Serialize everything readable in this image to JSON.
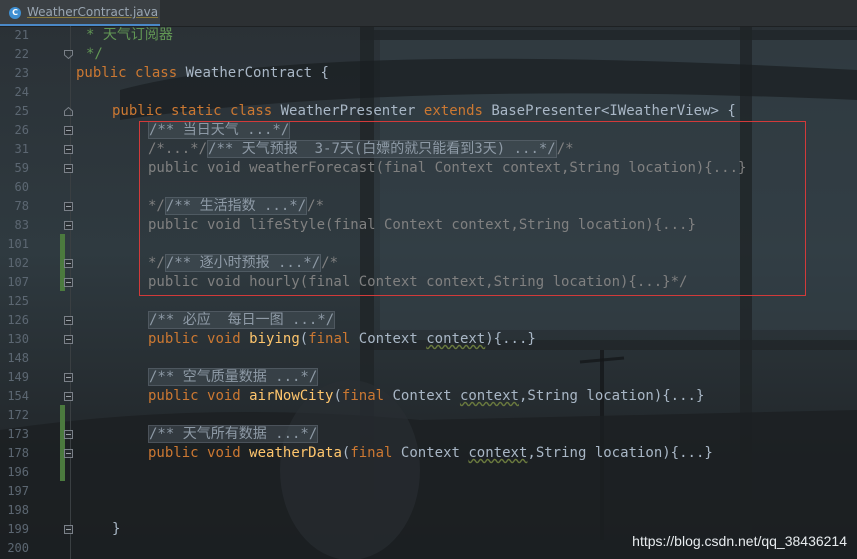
{
  "tab": {
    "title": "WeatherContract.java",
    "icon": "C"
  },
  "line_numbers": [
    "21",
    "22",
    "23",
    "24",
    "25",
    "26",
    "31",
    "59",
    "60",
    "78",
    "83",
    "101",
    "102",
    "107",
    "125",
    "126",
    "130",
    "148",
    "149",
    "154",
    "172",
    "173",
    "178",
    "196",
    "197",
    "198",
    "199",
    "200"
  ],
  "code": {
    "l21": "* 天气订阅器",
    "l22": "*/",
    "l23_kw1": "public",
    "l23_kw2": "class",
    "l23_rest": "WeatherContract {",
    "l25_kw1": "public",
    "l25_kw2": "static",
    "l25_kw3": "class",
    "l25_name": "WeatherPresenter",
    "l25_kw4": "extends",
    "l25_rest": "BasePresenter<IWeatherView> {",
    "l26": "/** 当日天气 ...*/",
    "l31_a": "/*...*/",
    "l31_b": "/** 天气预报  3-7天(白嫖的就只能看到3天) ...*/",
    "l31_c": "/*",
    "l59": "public void weatherForecast(final Context context,String location){...}",
    "l78_a": "*/",
    "l78_b": "/** 生活指数 ...*/",
    "l78_c": "/*",
    "l83": "public void lifeStyle(final Context context,String location){...}",
    "l102_a": "*/",
    "l102_b": "/** 逐小时预报 ...*/",
    "l102_c": "/*",
    "l107": "public void hourly(final Context context,String location){...}*/",
    "l126": "/** 必应  每日一图 ...*/",
    "l130_kw1": "public",
    "l130_kw2": "void",
    "l130_fn": "biying",
    "l130_kw3": "final",
    "l130_type": "Context",
    "l130_param": "context",
    "l130_rest": "){...}",
    "l149": "/** 空气质量数据 ...*/",
    "l154_kw1": "public",
    "l154_kw2": "void",
    "l154_fn": "airNowCity",
    "l154_kw3": "final",
    "l154_type": "Context",
    "l154_param": "context",
    "l154_rest": ",String location){...}",
    "l173": "/** 天气所有数据 ...*/",
    "l178_kw1": "public",
    "l178_kw2": "void",
    "l178_fn": "weatherData",
    "l178_kw3": "final",
    "l178_type": "Context",
    "l178_param": "context",
    "l178_rest": ",String location){...}",
    "l199": "}"
  },
  "watermark": "https://blog.csdn.net/qq_38436214",
  "colors": {
    "keyword": "#cc7832",
    "comment": "#629755",
    "function": "#ffc66d",
    "highlight": "#d23a3a"
  }
}
